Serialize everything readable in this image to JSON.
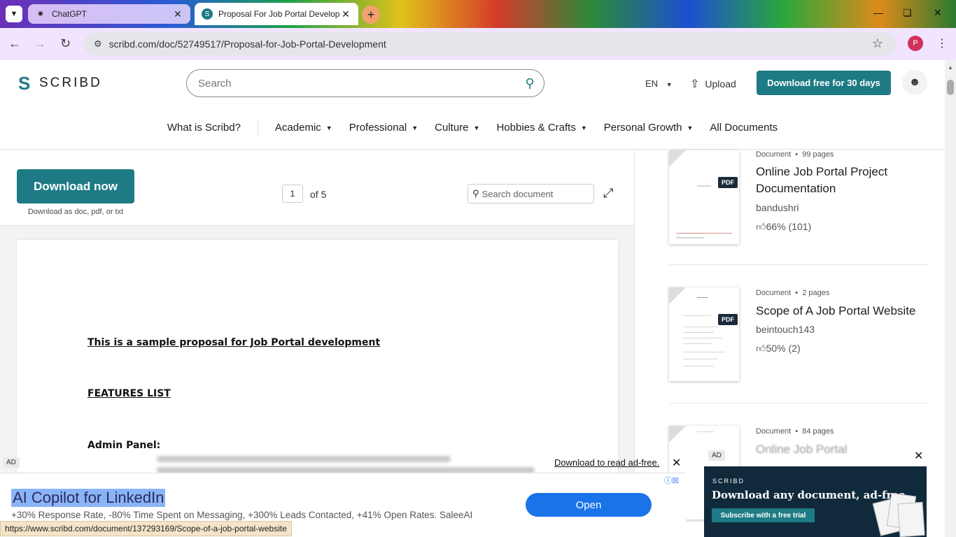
{
  "browser": {
    "tabs": [
      {
        "title": "ChatGPT",
        "active": false
      },
      {
        "title": "Proposal For Job Portal Develop",
        "active": true
      }
    ],
    "url": "scribd.com/doc/52749517/Proposal-for-Job-Portal-Development",
    "profile_initial": "P",
    "status_url": "https://www.scribd.com/document/137293169/Scope-of-a-job-portal-website"
  },
  "header": {
    "logo_text": "SCRIBD",
    "search_placeholder": "Search",
    "language": "EN",
    "upload_label": "Upload",
    "trial_button": "Download free for 30 days"
  },
  "nav": {
    "items": [
      {
        "label": "What is Scribd?",
        "dropdown": false
      },
      {
        "label": "Academic",
        "dropdown": true
      },
      {
        "label": "Professional",
        "dropdown": true
      },
      {
        "label": "Culture",
        "dropdown": true
      },
      {
        "label": "Hobbies & Crafts",
        "dropdown": true
      },
      {
        "label": "Personal Growth",
        "dropdown": true
      },
      {
        "label": "All Documents",
        "dropdown": false
      }
    ]
  },
  "doc_toolbar": {
    "download_button": "Download now",
    "download_sub": "Download as doc, pdf, or txt",
    "current_page": "1",
    "page_total": "of 5",
    "search_placeholder": "Search document"
  },
  "document": {
    "heading": "This is a sample proposal for Job Portal development",
    "features": "FEATURES LIST",
    "admin": "Admin Panel:"
  },
  "related": [
    {
      "type": "Document",
      "pages": "99 pages",
      "title": "Online Job Portal Project Documentation",
      "author": "bandushri",
      "rating": "66% (101)",
      "badge": "PDF"
    },
    {
      "type": "Document",
      "pages": "2 pages",
      "title": "Scope of A Job Portal Website",
      "author": "beintouch143",
      "rating": "50% (2)",
      "badge": "PDF"
    },
    {
      "type": "Document",
      "pages": "84 pages",
      "title": "Online Job Portal",
      "author": "",
      "rating": "",
      "badge": ""
    }
  ],
  "ads": {
    "tag": "AD",
    "read_adfree_link": "Download to read ad-free.",
    "title": "AI Copilot for LinkedIn",
    "description": "+30% Response Rate, -80% Time Spent on Messaging, +300% Leads Contacted, +41% Open Rates. SaleeAI",
    "open_button": "Open",
    "promo_brand": "SCRIBD",
    "promo_title": "Download any document, ad-free.",
    "promo_button": "Subscribe with a free trial"
  },
  "colors": {
    "accent": "#1e7b85",
    "ad_button": "#1a73e8",
    "promo_bg": "#102a3c"
  }
}
